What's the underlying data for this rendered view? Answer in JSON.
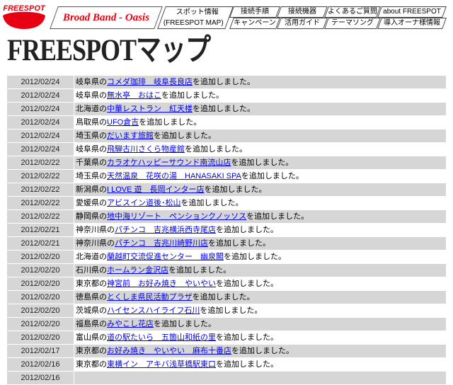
{
  "header": {
    "logo_text": "FREESPOT",
    "banner_text": "Broad Band - Oasis",
    "nav": {
      "spot_info_line1": "スポット情報",
      "spot_info_line2": "(FREESPOT MAP)",
      "connection_steps": "接続手順",
      "connection_devices": "接続機器",
      "faq": "よくあるご質問",
      "about": "about FREESPOT",
      "campaign": "キャンペーン",
      "usage_guide": "活用ガイド",
      "theme_song": "テーマソング",
      "owner_info": "導入オーナ様情報"
    }
  },
  "page_title": "FREESPOTマップ",
  "updates": [
    {
      "date": "2012/02/24",
      "prefix": "岐阜県の",
      "link": "コメダ珈琲　岐阜長良店",
      "suffix": "を追加しました。"
    },
    {
      "date": "2012/02/24",
      "prefix": "岐阜県の",
      "link": "無水亭　おはこ",
      "suffix": "を追加しました。"
    },
    {
      "date": "2012/02/24",
      "prefix": "北海道の",
      "link": "中華レストラン　紅天楼",
      "suffix": "を追加しました。"
    },
    {
      "date": "2012/02/24",
      "prefix": "鳥取県の",
      "link": "UFO倉吉",
      "suffix": "を追加しました。"
    },
    {
      "date": "2012/02/24",
      "prefix": "埼玉県の",
      "link": "だいます旅館",
      "suffix": "を追加しました。"
    },
    {
      "date": "2012/02/24",
      "prefix": "岐阜県の",
      "link": "飛騨古川さくら物産館",
      "suffix": "を追加しました。"
    },
    {
      "date": "2012/02/22",
      "prefix": "千葉県の",
      "link": "カラオケハッピーサウンド南流山店",
      "suffix": "を追加しました。"
    },
    {
      "date": "2012/02/22",
      "prefix": "埼玉県の",
      "link": "天然温泉　花咲の湯　HANASAKI SPA",
      "suffix": "を追加しました。"
    },
    {
      "date": "2012/02/22",
      "prefix": "新潟県の",
      "link": "I LOVE 遊　長岡インター店",
      "suffix": "を追加しました。"
    },
    {
      "date": "2012/02/22",
      "prefix": "愛媛県の",
      "link": "アビスイン道後･松山",
      "suffix": "を追加しました。"
    },
    {
      "date": "2012/02/22",
      "prefix": "静岡県の",
      "link": "地中海リゾート　ペンションクノッソス",
      "suffix": "を追加しました。"
    },
    {
      "date": "2012/02/21",
      "prefix": "神奈川県の",
      "link": "パチンコ　吉兆横浜西寺尾店",
      "suffix": "を追加しました。"
    },
    {
      "date": "2012/02/21",
      "prefix": "神奈川県の",
      "link": "パチンコ　吉兆川崎野川店",
      "suffix": "を追加しました。"
    },
    {
      "date": "2012/02/20",
      "prefix": "北海道の",
      "link": "蘭越町交流促進センター　幽泉閣",
      "suffix": "を追加しました。"
    },
    {
      "date": "2012/02/20",
      "prefix": "石川県の",
      "link": "ホームラン金沢店",
      "suffix": "を追加しました。"
    },
    {
      "date": "2012/02/20",
      "prefix": "東京都の",
      "link": "神宮前　お好み焼き　やいやい",
      "suffix": "を追加しました。"
    },
    {
      "date": "2012/02/20",
      "prefix": "徳島県の",
      "link": "とくしま県民活動プラザ",
      "suffix": "を追加しました。"
    },
    {
      "date": "2012/02/20",
      "prefix": "茨城県の",
      "link": "ハイセンスハイライフ石川",
      "suffix": "を追加しました。"
    },
    {
      "date": "2012/02/20",
      "prefix": "福島県の",
      "link": "みやこし花店",
      "suffix": "を追加しました。"
    },
    {
      "date": "2012/02/20",
      "prefix": "富山県の",
      "link": "道の駅たいら　五箇山和紙の里",
      "suffix": "を追加しました。"
    },
    {
      "date": "2012/02/17",
      "prefix": "東京都の",
      "link": "お好み焼き　やいやい　麻布十番店",
      "suffix": "を追加しました。"
    },
    {
      "date": "2012/02/16",
      "prefix": "東京都の",
      "link": "東横イン　アキバ浅草橋駅東口",
      "suffix": "を追加しました。"
    },
    {
      "date": "2012/02/16"
    }
  ],
  "colors": {
    "accent": "#e60012",
    "row_gray": "#d6d6d6",
    "link": "#0000ee"
  }
}
